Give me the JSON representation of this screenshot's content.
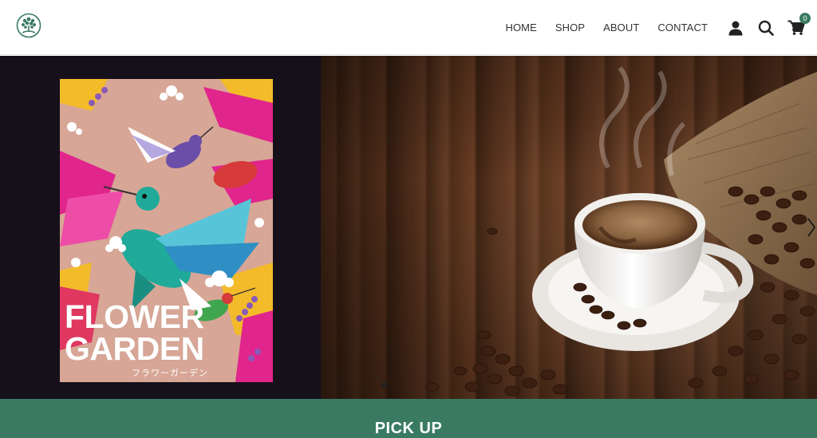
{
  "header": {
    "logo_icon": "tree-logo-icon",
    "nav": [
      {
        "label": "HOME"
      },
      {
        "label": "SHOP"
      },
      {
        "label": "ABOUT"
      },
      {
        "label": "CONTACT"
      }
    ],
    "icons": [
      "user-icon",
      "search-icon",
      "cart-icon"
    ],
    "cart_count": "0"
  },
  "hero": {
    "slides": [
      {
        "poster_title_line1": "FLOWER",
        "poster_title_line2": "GARDEN",
        "poster_subtitle": "フラワーガーデン"
      }
    ],
    "dots_count": 1,
    "arrows": [
      "chevron-left-icon",
      "chevron-right-icon"
    ]
  },
  "pickup": {
    "title": "PICK UP"
  },
  "colors": {
    "accent": "#3a7a62",
    "nav_text": "#333333",
    "poster_pink": "#d9a898"
  }
}
